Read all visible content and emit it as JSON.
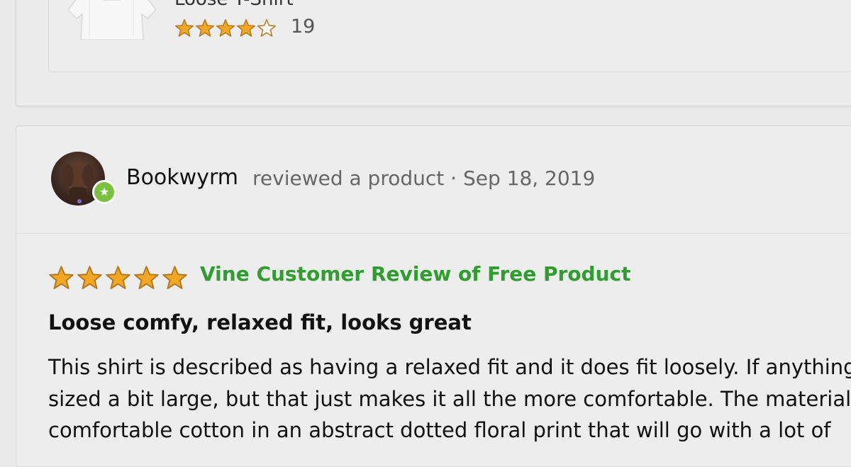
{
  "product": {
    "name": "Loose T-Shirt",
    "rating": 4,
    "rating_max": 5,
    "rating_count": "19"
  },
  "review": {
    "reviewer": "Bookwyrm",
    "meta": "reviewed a product · Sep 18, 2019",
    "rating": 5,
    "rating_max": 5,
    "vine_label": "Vine Customer Review of Free Product",
    "title": "Loose comfy, relaxed fit, looks great",
    "body_lines": [
      "This shirt is described as having a relaxed fit and it does fit loosely. If anything",
      "sized a bit large, but that just makes it all the more comfortable. The material",
      "comfortable cotton in an abstract dotted floral print that will go with a lot of"
    ]
  },
  "colors": {
    "star_fill": "#f0a723",
    "star_outline": "#b7791f",
    "vine_green": "#2f9e2f",
    "badge_green": "#7ac142"
  },
  "icons": {
    "star": "star-icon",
    "badge": "vine-badge-icon"
  }
}
